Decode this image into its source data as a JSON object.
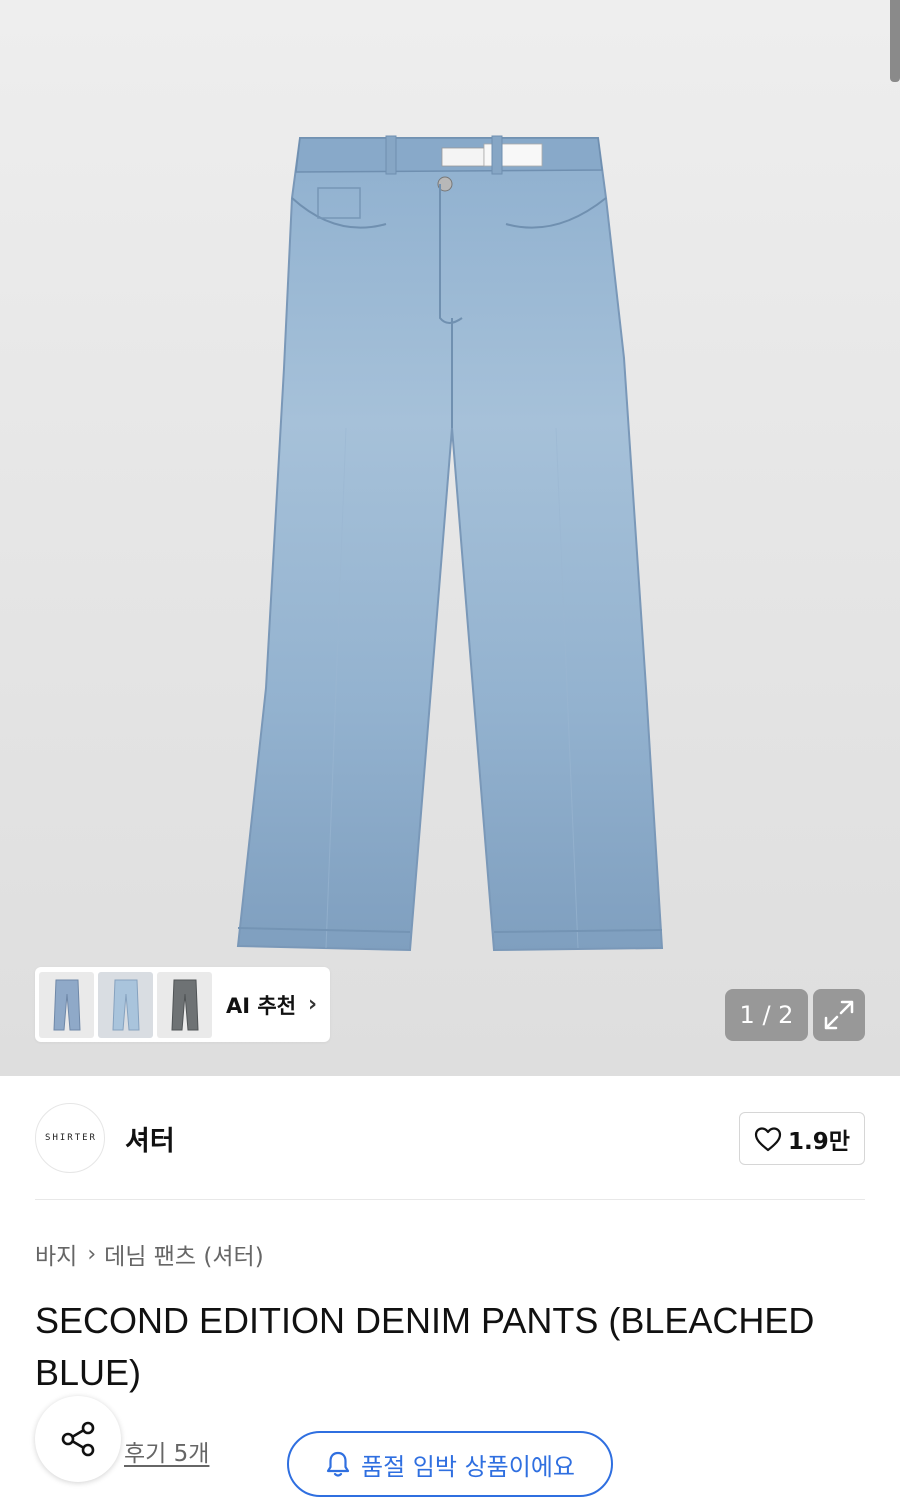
{
  "gallery": {
    "counter": "1 / 2",
    "ai_recommend_label": "AI 추천",
    "ai_thumbnails": [
      {
        "color": "#8fa9c8"
      },
      {
        "color": "#a9c4dc"
      },
      {
        "color": "#6e7274"
      }
    ]
  },
  "brand": {
    "logo_text": "SHIRTER",
    "name": "셔터",
    "likes": "1.9만"
  },
  "breadcrumb": {
    "category": "바지",
    "subcategory": "데님 팬츠 (셔터)"
  },
  "product": {
    "title": "SECOND EDITION DENIM PANTS (BLEACHED BLUE)"
  },
  "actions": {
    "reviews": "후기 5개",
    "soldout_notice": "품절 임박 상품이에요"
  },
  "colors": {
    "accent_blue": "#2f6fe0",
    "denim": "#8fb0cf"
  }
}
